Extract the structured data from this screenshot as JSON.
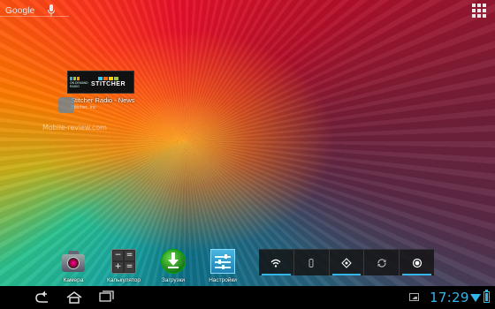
{
  "search": {
    "label": "Google"
  },
  "widget": {
    "brand": "STITCHER",
    "side_text": "ON DEMAND RADIO",
    "title": "Stitcher Radio - News",
    "subtitle": "Stitcher, Inc"
  },
  "watermark": "Mobile-review.com",
  "dock": [
    {
      "label": "Камера",
      "icon": "camera-icon"
    },
    {
      "label": "Калькулятор",
      "icon": "calculator-icon"
    },
    {
      "label": "Загрузки",
      "icon": "downloads-icon"
    },
    {
      "label": "Настройки",
      "icon": "settings-icon"
    }
  ],
  "calculator_keys": [
    "−",
    "=",
    "+",
    "="
  ],
  "power_controls": [
    {
      "name": "wifi-toggle",
      "icon": "wifi-icon",
      "on": true
    },
    {
      "name": "bluetooth-toggle",
      "icon": "bluetooth-icon",
      "on": false
    },
    {
      "name": "gps-toggle",
      "icon": "gps-icon",
      "on": true
    },
    {
      "name": "sync-toggle",
      "icon": "sync-icon",
      "on": false
    },
    {
      "name": "brightness-toggle",
      "icon": "brightness-icon",
      "on": true
    }
  ],
  "status": {
    "time": "17:29"
  },
  "colors": {
    "accent": "#33b5e5"
  }
}
